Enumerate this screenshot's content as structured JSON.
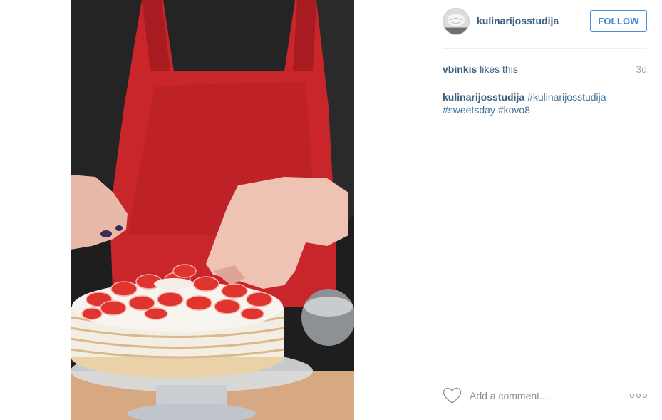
{
  "post": {
    "image_alt": "Hands placing strawberry slices on a layered crepe cake",
    "author": "kulinarijosstudija",
    "follow_label": "FOLLOW",
    "liked_by": "vbinkis",
    "likes_suffix": "likes this",
    "time_ago": "3d",
    "caption": {
      "user": "kulinarijosstudija",
      "hashtags": [
        "#kulinarijosstudija",
        "#sweetsday",
        "#kovo8"
      ]
    },
    "comment_placeholder": "Add a comment...",
    "icons": {
      "like": "heart-outline-icon",
      "more": "more-options-icon"
    },
    "colors": {
      "link": "#3b5f7e",
      "follow": "#3f87d6",
      "muted": "#a5a7aa"
    }
  }
}
